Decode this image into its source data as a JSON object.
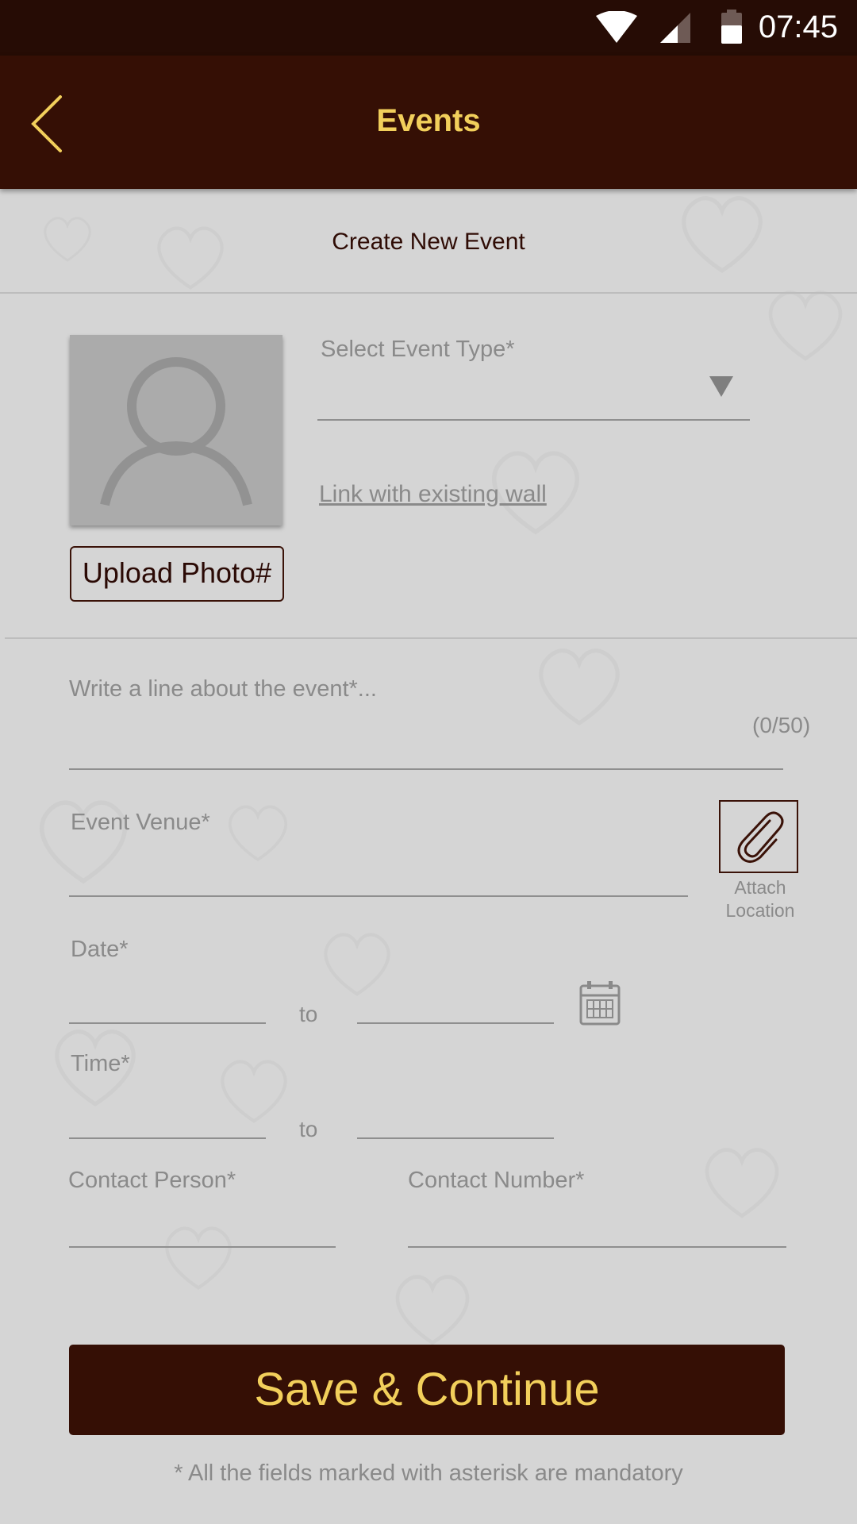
{
  "status_bar": {
    "time": "07:45"
  },
  "app_bar": {
    "title": "Events"
  },
  "form": {
    "section_title": "Create New Event",
    "upload_photo_label": "Upload Photo#",
    "event_type_label": "Select Event Type*",
    "link_wall_label": "Link with existing wall",
    "description_placeholder": "Write a line about the event*...",
    "char_counter": "(0/50)",
    "venue_label": "Event Venue*",
    "attach_location_label": "Attach\nLocation",
    "date_label": "Date*",
    "time_label": "Time*",
    "to_label": "to",
    "contact_person_label": "Contact Person*",
    "contact_number_label": "Contact Number*",
    "save_button": "Save & Continue",
    "mandatory_note": "* All the fields marked with asterisk are mandatory"
  },
  "colors": {
    "status_bar": "#260c05",
    "app_bar": "#350f05",
    "accent_gold": "#f2cf5b",
    "background": "#d5d5d5"
  },
  "icons": [
    "wifi-icon",
    "signal-icon",
    "battery-icon",
    "back-arrow-icon",
    "avatar-placeholder-icon",
    "dropdown-arrow-icon",
    "paperclip-icon",
    "calendar-icon"
  ]
}
